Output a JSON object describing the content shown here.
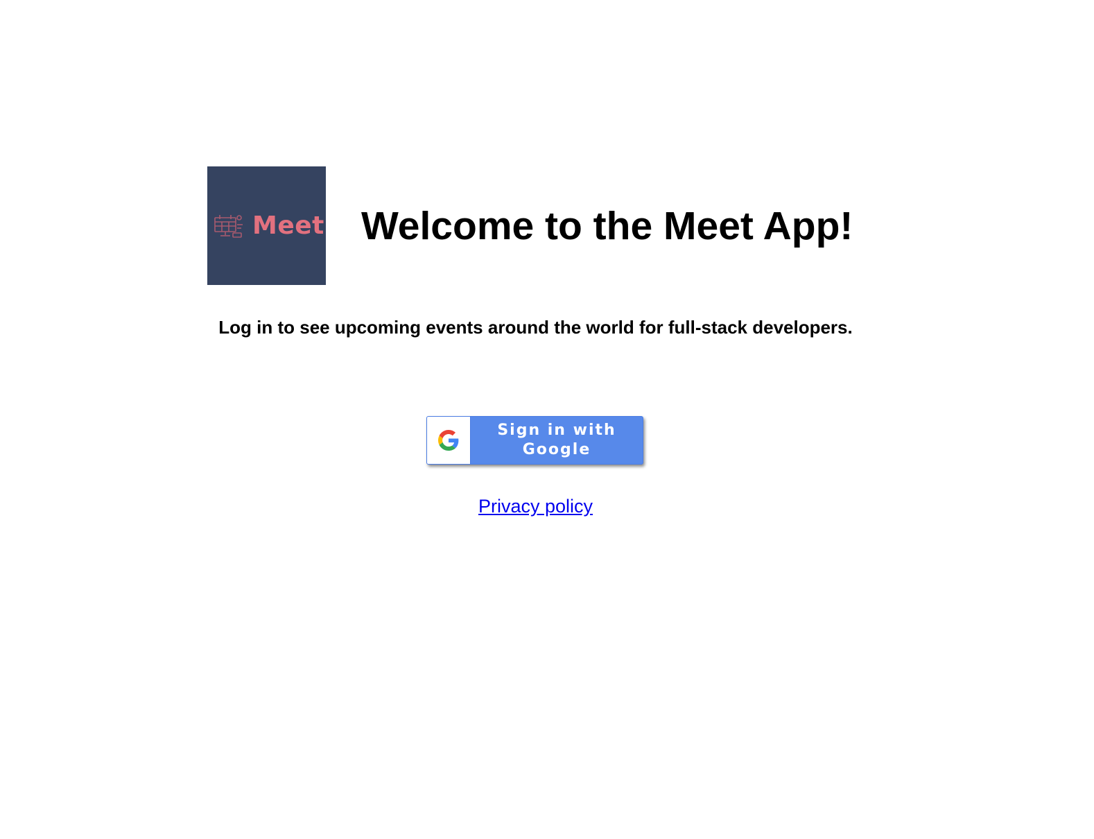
{
  "logo": {
    "text": "Meet",
    "icon": "calendar-monitor-icon",
    "background_color": "#354360",
    "text_color": "#e2717f"
  },
  "header": {
    "title": "Welcome to the Meet App!"
  },
  "intro": {
    "text": "Log in to see upcoming events around the world for full-stack developers."
  },
  "google_signin": {
    "label": "Sign in with Google",
    "icon": "google-g-icon",
    "color": "#5789ea"
  },
  "footer": {
    "privacy_label": "Privacy policy",
    "link_color": "#0000ee"
  }
}
